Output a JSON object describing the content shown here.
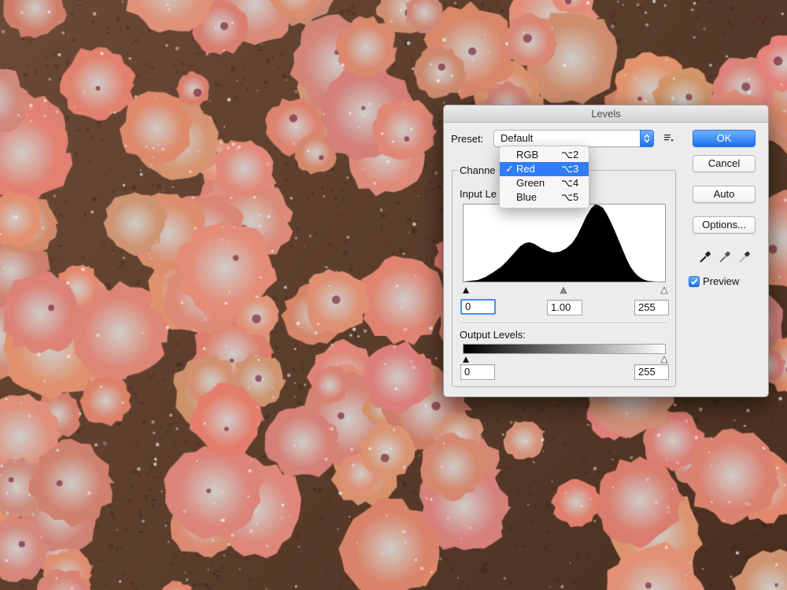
{
  "dialog": {
    "title": "Levels",
    "preset_label": "Preset:",
    "preset_value": "Default",
    "channel_label": "Channe",
    "input_levels_label": "Input Le",
    "input_black": "0",
    "input_gamma": "1.00",
    "input_white": "255",
    "output_levels_label": "Output Levels:",
    "output_black": "0",
    "output_white": "255",
    "buttons": {
      "ok": "OK",
      "cancel": "Cancel",
      "auto": "Auto",
      "options": "Options..."
    },
    "preview_label": "Preview",
    "preview_checked": true
  },
  "channel_menu": {
    "items": [
      {
        "label": "RGB",
        "shortcut": "⌥2",
        "checked": false,
        "highlighted": false
      },
      {
        "label": "Red",
        "shortcut": "⌥3",
        "checked": true,
        "highlighted": true
      },
      {
        "label": "Green",
        "shortcut": "⌥4",
        "checked": false,
        "highlighted": false
      },
      {
        "label": "Blue",
        "shortcut": "⌥5",
        "checked": false,
        "highlighted": false
      }
    ],
    "check_glyph": "✓"
  },
  "colors": {
    "accent": "#2f7cf6",
    "dialog_bg": "#ececec",
    "histogram_fill": "#000000"
  },
  "icons": {
    "preset_stepper": "up-down-chevron-icon",
    "preset_menu": "list-menu-icon",
    "eyedroppers": [
      "black-eyedropper-icon",
      "gray-eyedropper-icon",
      "white-eyedropper-icon"
    ]
  }
}
